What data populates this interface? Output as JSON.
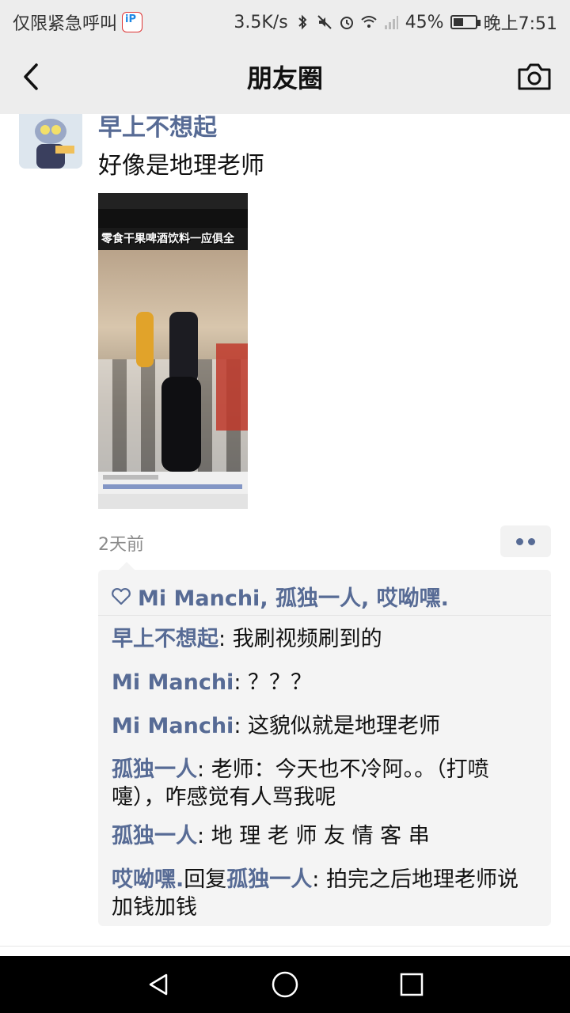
{
  "status_bar": {
    "left_text": "仅限紧急呼叫",
    "network_speed": "3.5K/s",
    "battery_percent": "45%",
    "battery_level": 0.45,
    "time": "晚上7:51"
  },
  "nav": {
    "title": "朋友圈"
  },
  "post": {
    "author": "早上不想起",
    "text": "好像是地理老师",
    "video_banner": "零食干果啤酒饮料一应俱全",
    "time_ago": "2天前",
    "likes": "Mi Manchi, 孤独一人, 哎呦嘿."
  },
  "comments": [
    {
      "name": "早上不想起",
      "sep": ": ",
      "text": "我刷视频刷到的"
    },
    {
      "name": "Mi Manchi",
      "sep": ": ",
      "text": "？？？"
    },
    {
      "name": "Mi Manchi",
      "sep": ": ",
      "text": "这貌似就是地理老师"
    },
    {
      "name": "孤独一人",
      "sep": ": ",
      "text": "老师：今天也不冷阿。。（打喷嚏），咋感觉有人骂我呢"
    },
    {
      "name": "孤独一人",
      "sep": ": ",
      "text": "地 理 老 师 友 情 客 串"
    },
    {
      "name": "哎呦嘿.",
      "reply_word": "回复",
      "reply_to": "孤独一人",
      "sep": ": ",
      "text": "拍完之后地理老师说加钱加钱"
    }
  ],
  "icons": {
    "back": "chevron-left-icon",
    "camera": "camera-icon",
    "heart": "heart-icon",
    "more": "more-dots-icon"
  },
  "colors": {
    "link": "#576b95",
    "header_bg": "#ededed",
    "comment_bg": "#f4f4f4"
  }
}
